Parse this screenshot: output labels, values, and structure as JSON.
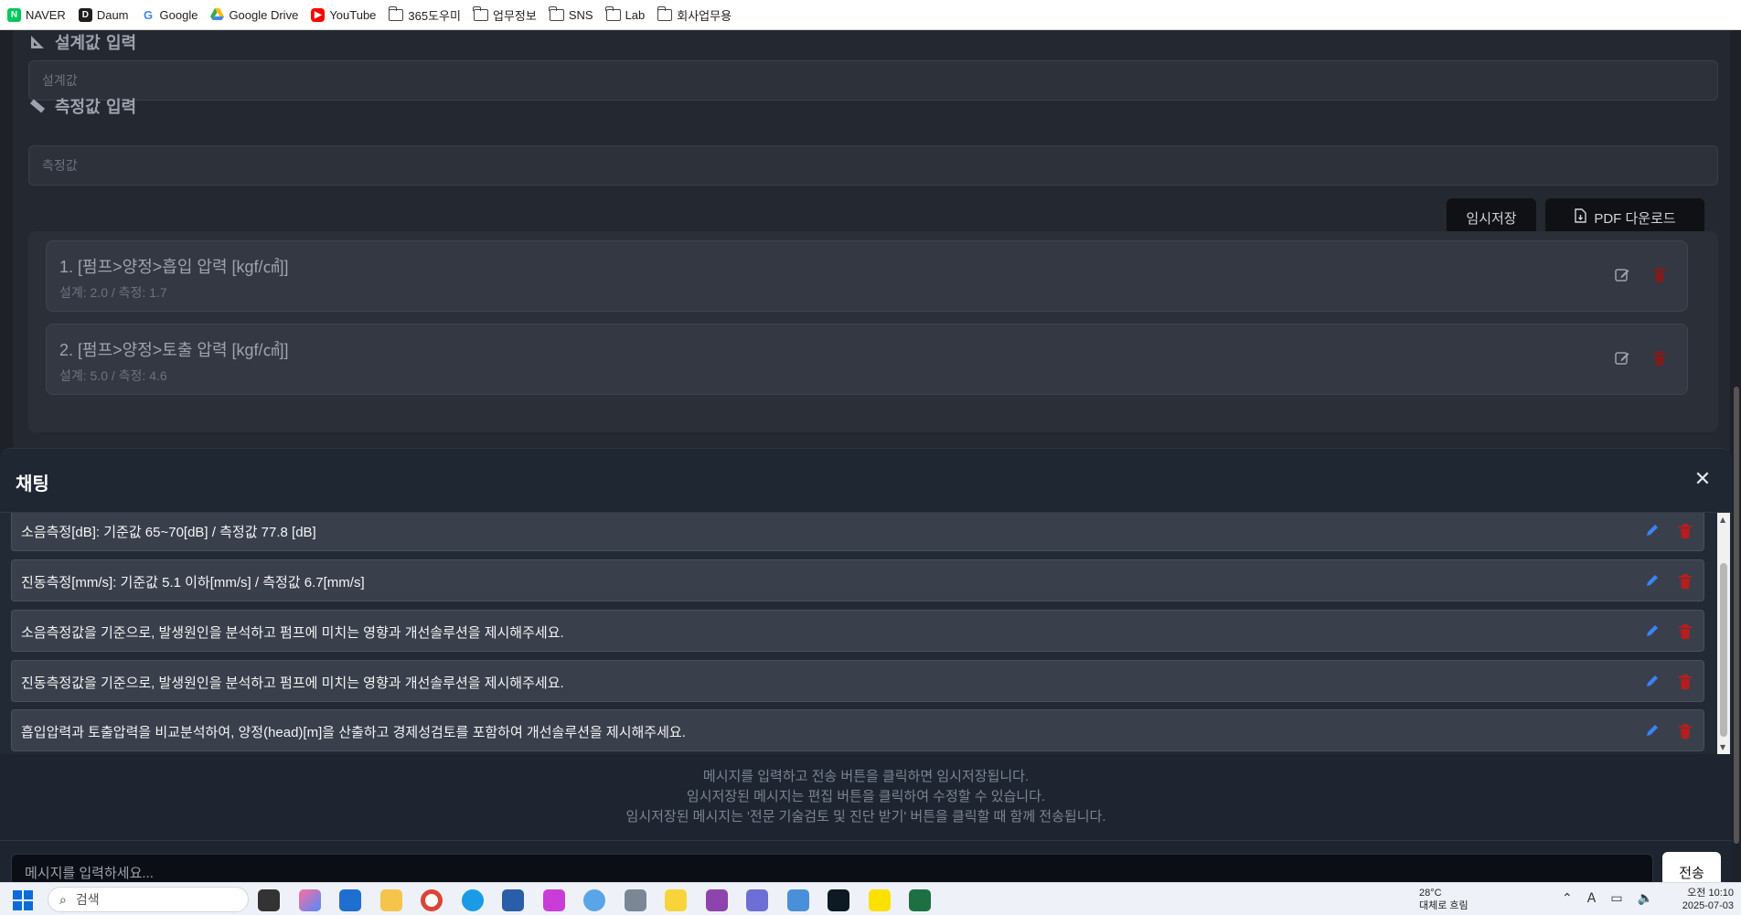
{
  "bookmarks": [
    {
      "label": "NAVER",
      "icon": "naver-icon"
    },
    {
      "label": "Daum",
      "icon": "daum-icon"
    },
    {
      "label": "Google",
      "icon": "google-icon"
    },
    {
      "label": "Google Drive",
      "icon": "drive-icon"
    },
    {
      "label": "YouTube",
      "icon": "youtube-icon"
    },
    {
      "label": "365도우미",
      "icon": "folder-icon"
    },
    {
      "label": "업무정보",
      "icon": "folder-icon"
    },
    {
      "label": "SNS",
      "icon": "folder-icon"
    },
    {
      "label": "Lab",
      "icon": "folder-icon"
    },
    {
      "label": "회사업무용",
      "icon": "folder-icon"
    }
  ],
  "form": {
    "design_label": "설계값 입력",
    "design_placeholder": "설계값",
    "measure_label": "측정값 입력",
    "measure_placeholder": "측정값",
    "temp_save_button": "임시저장",
    "pdf_button": "PDF 다운로드"
  },
  "items": [
    {
      "title": "1. [펌프>양정>흡입 압력 [kgf/㎠]]",
      "sub": "설계: 2.0 / 측정: 1.7"
    },
    {
      "title": "2. [펌프>양정>토출 압력 [kgf/㎠]]",
      "sub": "설계: 5.0 / 측정: 4.6"
    }
  ],
  "chat": {
    "title": "채팅",
    "messages": [
      "소음측정[dB]: 기준값 65~70[dB] / 측정값 77.8 [dB]",
      "진동측정[mm/s]: 기준값 5.1 이하[mm/s] / 측정값 6.7[mm/s]",
      "소음측정값을 기준으로, 발생원인을 분석하고 펌프에 미치는 영향과 개선솔루션을 제시해주세요.",
      "진동측정값을 기준으로, 발생원인을 분석하고 펌프에 미치는 영향과 개선솔루션을 제시해주세요.",
      "흡입압력과 토출압력을 비교분석하여, 양정(head)[m]을 산출하고 경제성검토를 포함하여 개선솔루션을 제시해주세요."
    ],
    "hints": [
      "메시지를 입력하고 전송 버튼을 클릭하면 임시저장됩니다.",
      "임시저장된 메시지는 편집 버튼을 클릭하여 수정할 수 있습니다.",
      "임시저장된 메시지는 '전문 기술검토 및 진단 받기' 버튼을 클릭할 때 함께 전송됩니다."
    ],
    "input_placeholder": "메시지를 입력하세요...",
    "send_button": "전송"
  },
  "taskbar": {
    "search_placeholder": "검색",
    "weather_temp": "28°C",
    "weather_desc": "대체로 흐림",
    "time": "오전 10:10",
    "date": "2025-07-03"
  },
  "colors": {
    "accent_blue": "#3b82f6",
    "danger_red": "#b91c1c",
    "naver_green": "#03c75a",
    "youtube_red": "#ff0000"
  }
}
